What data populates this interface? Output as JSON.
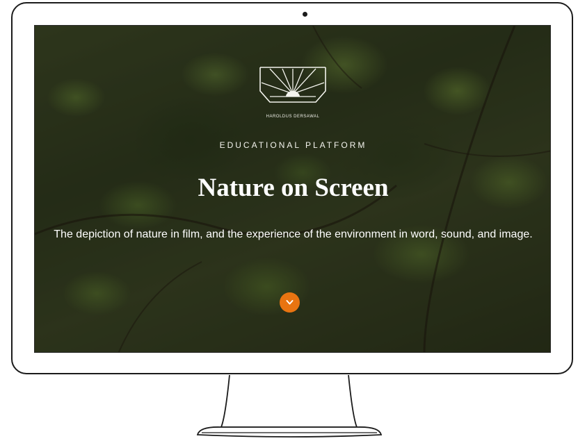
{
  "hero": {
    "logo_caption": "Haroldus Dersawal",
    "kicker": "EDUCATIONAL PLATFORM",
    "title": "Nature on Screen",
    "subtitle": "The depiction of nature in film, and the experience of the environment in word, sound, and image."
  },
  "scroll_button": {
    "icon": "chevron-down-icon",
    "color": "#e87411"
  },
  "colors": {
    "frame": "#1b1b1b",
    "accent": "#e87411"
  }
}
